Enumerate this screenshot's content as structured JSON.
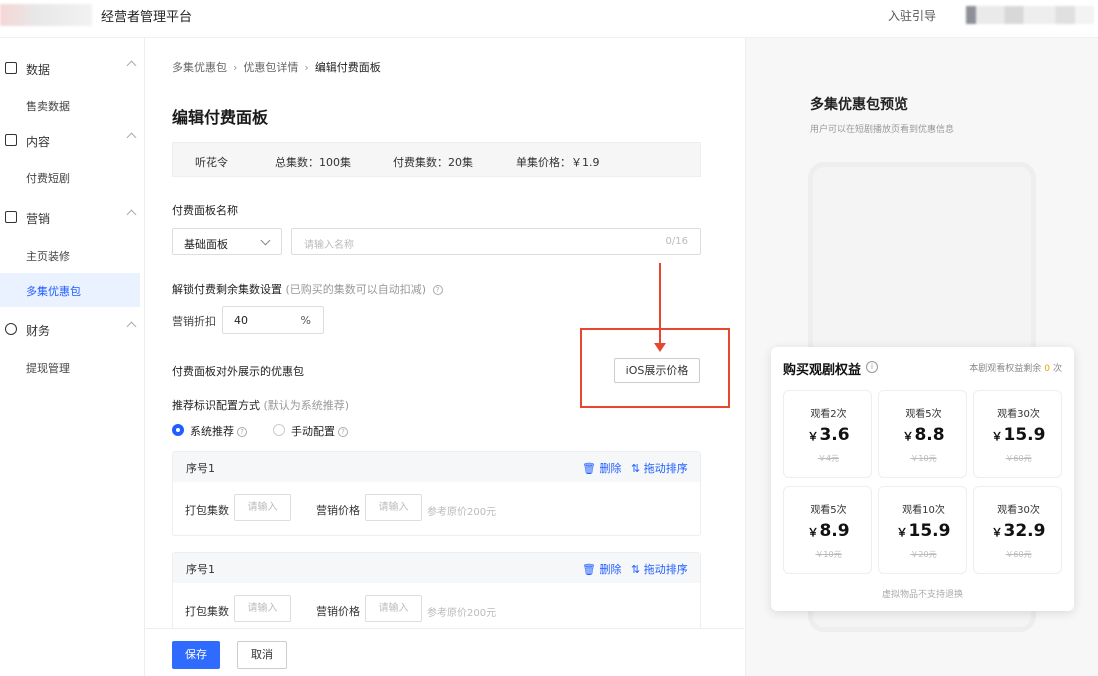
{
  "header": {
    "app_title": "经营者管理平台",
    "guide_link": "入驻引导"
  },
  "sidebar": {
    "groups": [
      {
        "label": "数据",
        "icon": "chart-icon"
      },
      {
        "label": "内容",
        "icon": "video-icon"
      },
      {
        "label": "营销",
        "icon": "bag-icon"
      },
      {
        "label": "财务",
        "icon": "database-icon"
      }
    ],
    "items": [
      "售卖数据",
      "付费短剧",
      "主页装修",
      "多集优惠包",
      "提现管理"
    ],
    "active_item": "多集优惠包"
  },
  "breadcrumb": [
    "多集优惠包",
    "优惠包详情",
    "编辑付费面板"
  ],
  "page_title": "编辑付费面板",
  "info_bar": {
    "name": "听花令",
    "total": "总集数：100集",
    "paid": "付费集数：20集",
    "unit_price": "单集价格：￥1.9"
  },
  "panel_name": {
    "label": "付费面板名称",
    "select_value": "基础面板",
    "input_placeholder": "请输入名称",
    "counter": "0/16"
  },
  "unlock": {
    "label": "解锁付费剩余集数设置",
    "hint": "(已购买的集数可以自动扣减)",
    "discount_label": "营销折扣",
    "discount_value": "40",
    "discount_unit": "%"
  },
  "offers": {
    "label": "付费面板对外展示的优惠包",
    "ios_button": "iOS展示价格",
    "recommend_label": "推荐标识配置方式",
    "recommend_hint": "(默认为系统推荐)",
    "radio_system": "系统推荐",
    "radio_manual": "手动配置",
    "selected": "系统推荐"
  },
  "packages": [
    {
      "no": "序号1",
      "delete": "删除",
      "drag": "拖动排序",
      "count_label": "打包集数",
      "count_placeholder": "请输入",
      "price_label": "营销价格",
      "price_placeholder": "请输入",
      "ref": "参考原价200元"
    },
    {
      "no": "序号1",
      "delete": "删除",
      "drag": "拖动排序",
      "count_label": "打包集数",
      "count_placeholder": "请输入",
      "price_label": "营销价格",
      "price_placeholder": "请输入",
      "ref": "参考原价200元"
    }
  ],
  "buttons": {
    "save": "保存",
    "cancel": "取消"
  },
  "preview": {
    "title": "多集优惠包预览",
    "subtitle": "用户可以在短剧播放页看到优惠信息",
    "panel_title": "购买观剧权益",
    "remain_prefix": "本剧观看权益剩余",
    "remain_value": "0",
    "remain_suffix": "次",
    "tiles": [
      {
        "title": "观看2次",
        "price": "3.6",
        "orig": "￥4元"
      },
      {
        "title": "观看5次",
        "price": "8.8",
        "orig": "￥10元"
      },
      {
        "title": "观看30次",
        "price": "15.9",
        "orig": "￥60元"
      },
      {
        "title": "观看5次",
        "price": "8.9",
        "orig": "￥10元"
      },
      {
        "title": "观看10次",
        "price": "15.9",
        "orig": "￥20元"
      },
      {
        "title": "观看30次",
        "price": "32.9",
        "orig": "￥60元"
      }
    ],
    "currency": "￥",
    "footer": "虚拟物品不支持退换"
  },
  "colors": {
    "primary": "#2f6bff",
    "annotation_red": "#e8472f",
    "remain_accent": "#f0a000"
  }
}
